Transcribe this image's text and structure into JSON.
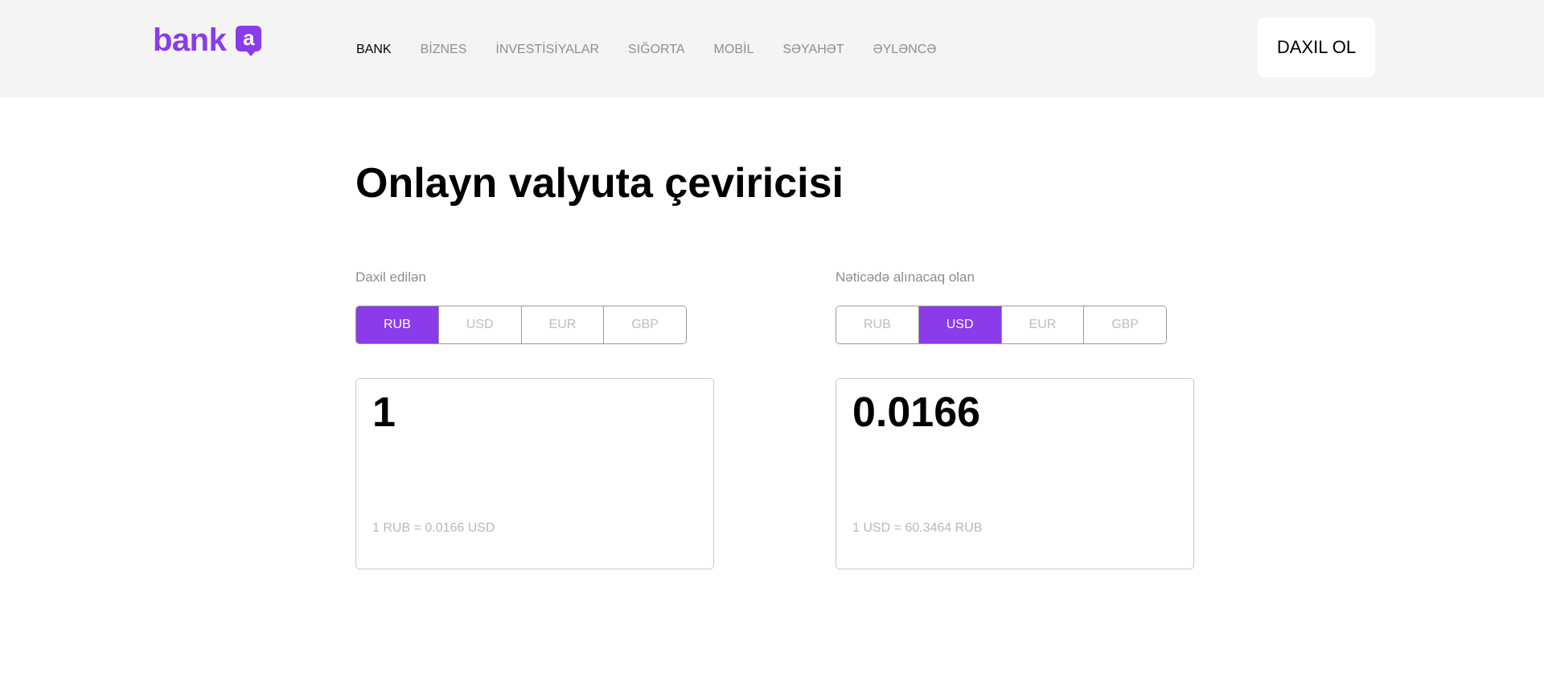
{
  "brand": {
    "name": "bank",
    "badge_letter": "a",
    "color": "#8a3bea"
  },
  "nav": {
    "items": [
      {
        "label": "BANK",
        "active": true
      },
      {
        "label": "BİZNES",
        "active": false
      },
      {
        "label": "İNVESTİSİYALAR",
        "active": false
      },
      {
        "label": "SIĞORTA",
        "active": false
      },
      {
        "label": "MOBİL",
        "active": false
      },
      {
        "label": "SƏYAHƏT",
        "active": false
      },
      {
        "label": "ƏYLƏNCƏ",
        "active": false
      }
    ]
  },
  "login_label": "DAXIL OL",
  "page_title": "Onlayn valyuta çeviricisi",
  "converter": {
    "from": {
      "label": "Daxil edilən",
      "currencies": [
        "RUB",
        "USD",
        "EUR",
        "GBP"
      ],
      "selected": "RUB",
      "amount": "1",
      "rate_text": "1 RUB = 0.0166 USD"
    },
    "to": {
      "label": "Nəticədə alınacaq olan",
      "currencies": [
        "RUB",
        "USD",
        "EUR",
        "GBP"
      ],
      "selected": "USD",
      "amount": "0.0166",
      "rate_text": "1 USD = 60.3464 RUB"
    }
  }
}
